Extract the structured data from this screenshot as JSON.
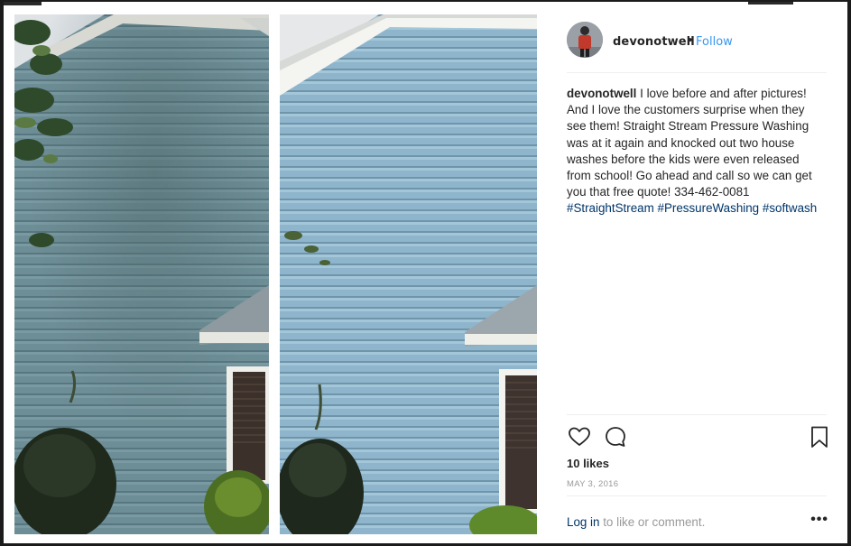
{
  "post": {
    "username": "devonotwell",
    "dot": "•",
    "follow_label": "Follow",
    "caption_user": "devonotwell",
    "caption_text": "I love before and after pictures! And I love the customers surprise when they see them! Straight Stream Pressure Washing was at it again and knocked out two house washes before the kids were even released from school! Go ahead and call so we can get you that free quote! 334-462-0081",
    "hashtags": [
      "#StraightStream",
      "#PressureWashing",
      "#softwash"
    ],
    "likes": "10 likes",
    "date": "MAY 3, 2016",
    "login_link": "Log in",
    "login_text": " to like or comment.",
    "more_label": "•••"
  },
  "icons": {
    "like": "heart-icon",
    "comment": "comment-icon",
    "save": "bookmark-icon",
    "options": "more-options-icon"
  },
  "colors": {
    "link_blue": "#3897f0",
    "hashtag_blue": "#003569",
    "text": "#262626",
    "muted": "#999999",
    "siding_before": "#6f8f98",
    "siding_after": "#8fb6cc"
  }
}
